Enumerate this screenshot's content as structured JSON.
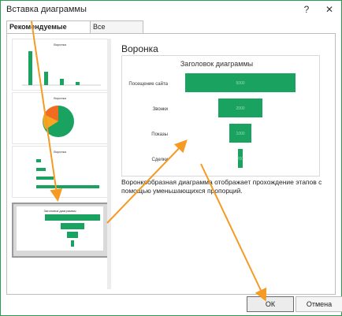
{
  "dialog": {
    "title": "Вставка диаграммы",
    "help_label": "?",
    "close_label": "✕"
  },
  "tabs": [
    {
      "label": "Рекомендуемые диаграммы",
      "active": true
    },
    {
      "label": "Все диаграммы",
      "active": false
    }
  ],
  "thumbnails": [
    {
      "title": "Воронка"
    },
    {
      "title": "Воронка"
    },
    {
      "title": "Воронка"
    },
    {
      "title": "Заголовок диаграммы"
    }
  ],
  "preview": {
    "heading": "Воронка",
    "chart_title": "Заголовок диаграммы",
    "description": "Воронкообразная диаграмма отображает прохождение этапов с помощью уменьшающихся пропорций."
  },
  "chart_data": {
    "type": "bar",
    "title": "Заголовок диаграммы",
    "categories": [
      "Посещение сайта",
      "Звонки",
      "Показы",
      "Сделки"
    ],
    "values": [
      5000,
      2000,
      1000,
      200
    ],
    "color": "#1aa260"
  },
  "buttons": {
    "ok": "ОК",
    "cancel": "Отмена"
  },
  "colors": {
    "accent": "#1aa260",
    "arrow": "#f59a23"
  }
}
